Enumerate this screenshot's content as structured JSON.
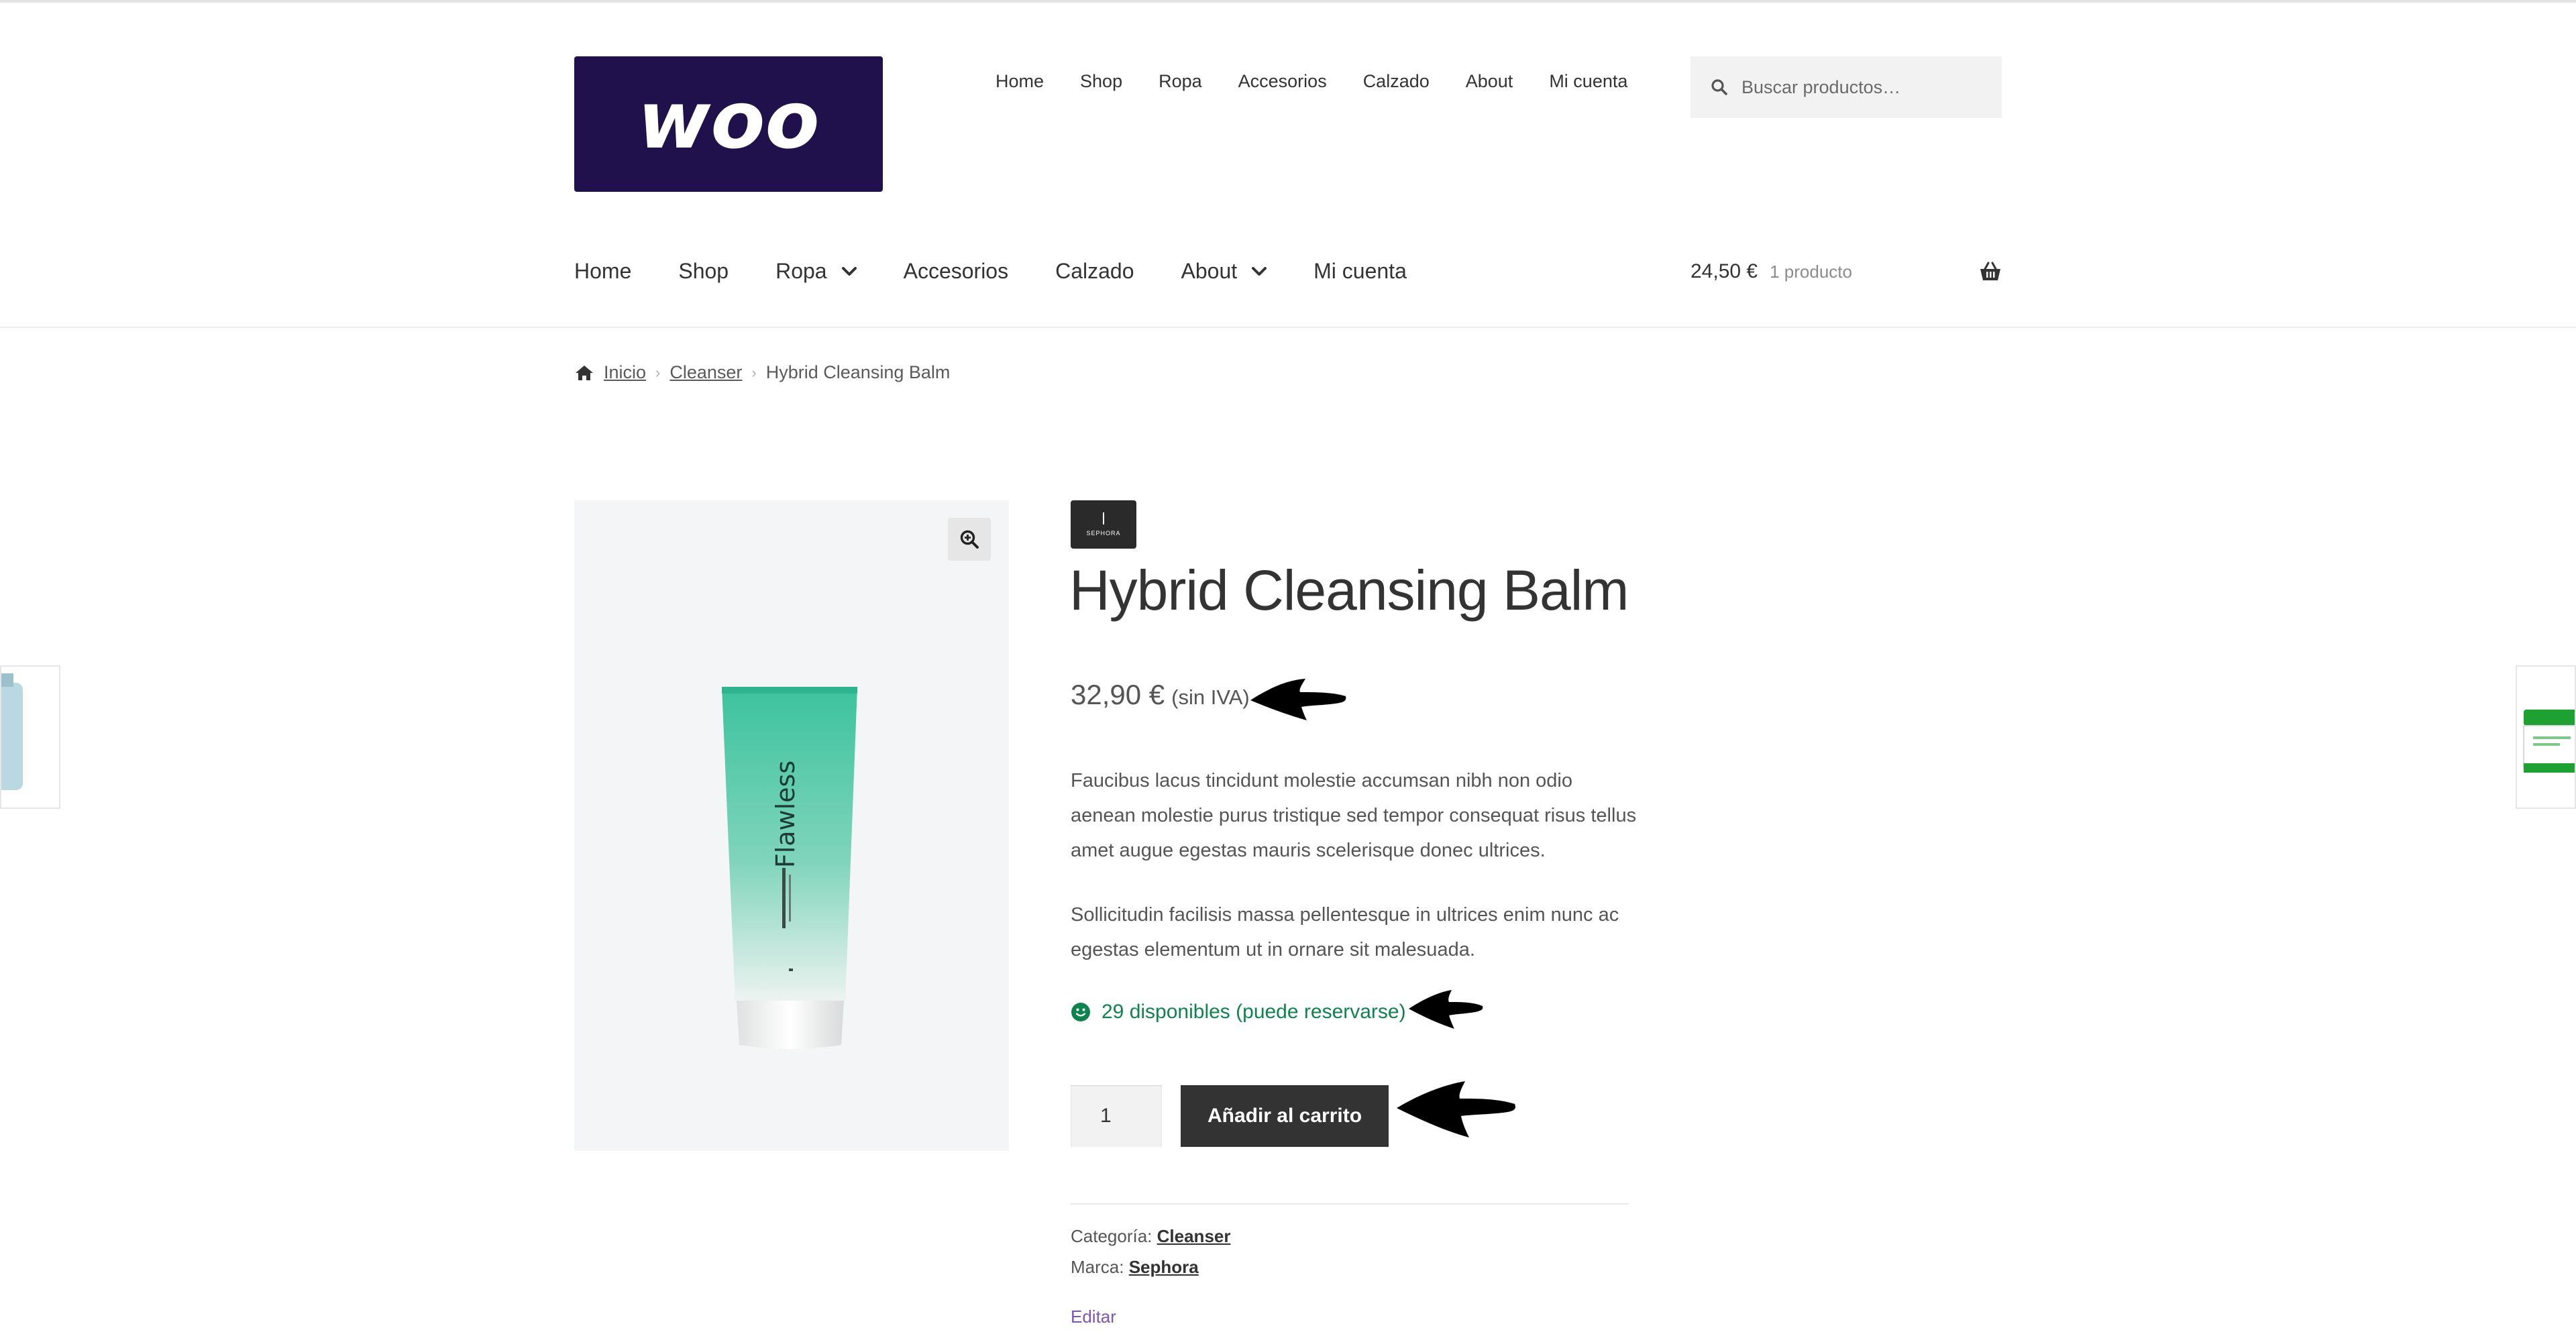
{
  "brand": {
    "logo_text": "woo",
    "logo_bg": "#20104c"
  },
  "secondary_nav": {
    "items": [
      "Home",
      "Shop",
      "Ropa",
      "Accesorios",
      "Calzado",
      "About",
      "Mi cuenta"
    ]
  },
  "search": {
    "placeholder": "Buscar productos…",
    "icon": "search-icon"
  },
  "primary_nav": {
    "items": [
      {
        "label": "Home",
        "has_dropdown": false
      },
      {
        "label": "Shop",
        "has_dropdown": false
      },
      {
        "label": "Ropa",
        "has_dropdown": true
      },
      {
        "label": "Accesorios",
        "has_dropdown": false
      },
      {
        "label": "Calzado",
        "has_dropdown": false
      },
      {
        "label": "About",
        "has_dropdown": true
      },
      {
        "label": "Mi cuenta",
        "has_dropdown": false
      }
    ]
  },
  "cart": {
    "amount": "24,50 €",
    "count": "1 producto",
    "icon": "basket-icon"
  },
  "breadcrumb": {
    "items": [
      "Inicio",
      "Cleanser"
    ],
    "current": "Hybrid Cleansing Balm",
    "icon": "home-icon"
  },
  "product": {
    "image_text": "Flawless",
    "brand_badge": "SEPHORA",
    "title": "Hybrid Cleansing Balm",
    "price": "32,90 €",
    "price_suffix": "(sin IVA)",
    "description": [
      "Faucibus lacus tincidunt molestie accumsan nibh non odio aenean molestie purus tristique sed tempor consequat risus tellus amet augue egestas mauris scelerisque donec ultrices.",
      "Sollicitudin facilisis massa pellentesque in ultrices enim nunc ac egestas elementum ut in ornare sit malesuada."
    ],
    "stock": "29 disponibles (puede reservarse)",
    "quantity": "1",
    "add_to_cart": "Añadir al carrito",
    "category_label": "Categoría:",
    "category": "Cleanser",
    "brand_label": "Marca:",
    "brand": "Sephora",
    "edit": "Editar"
  },
  "colors": {
    "accent_button": "#333333",
    "stock_green": "#0f834d",
    "edit_link": "#7f54b3",
    "gallery_bg": "#f4f5f7"
  }
}
